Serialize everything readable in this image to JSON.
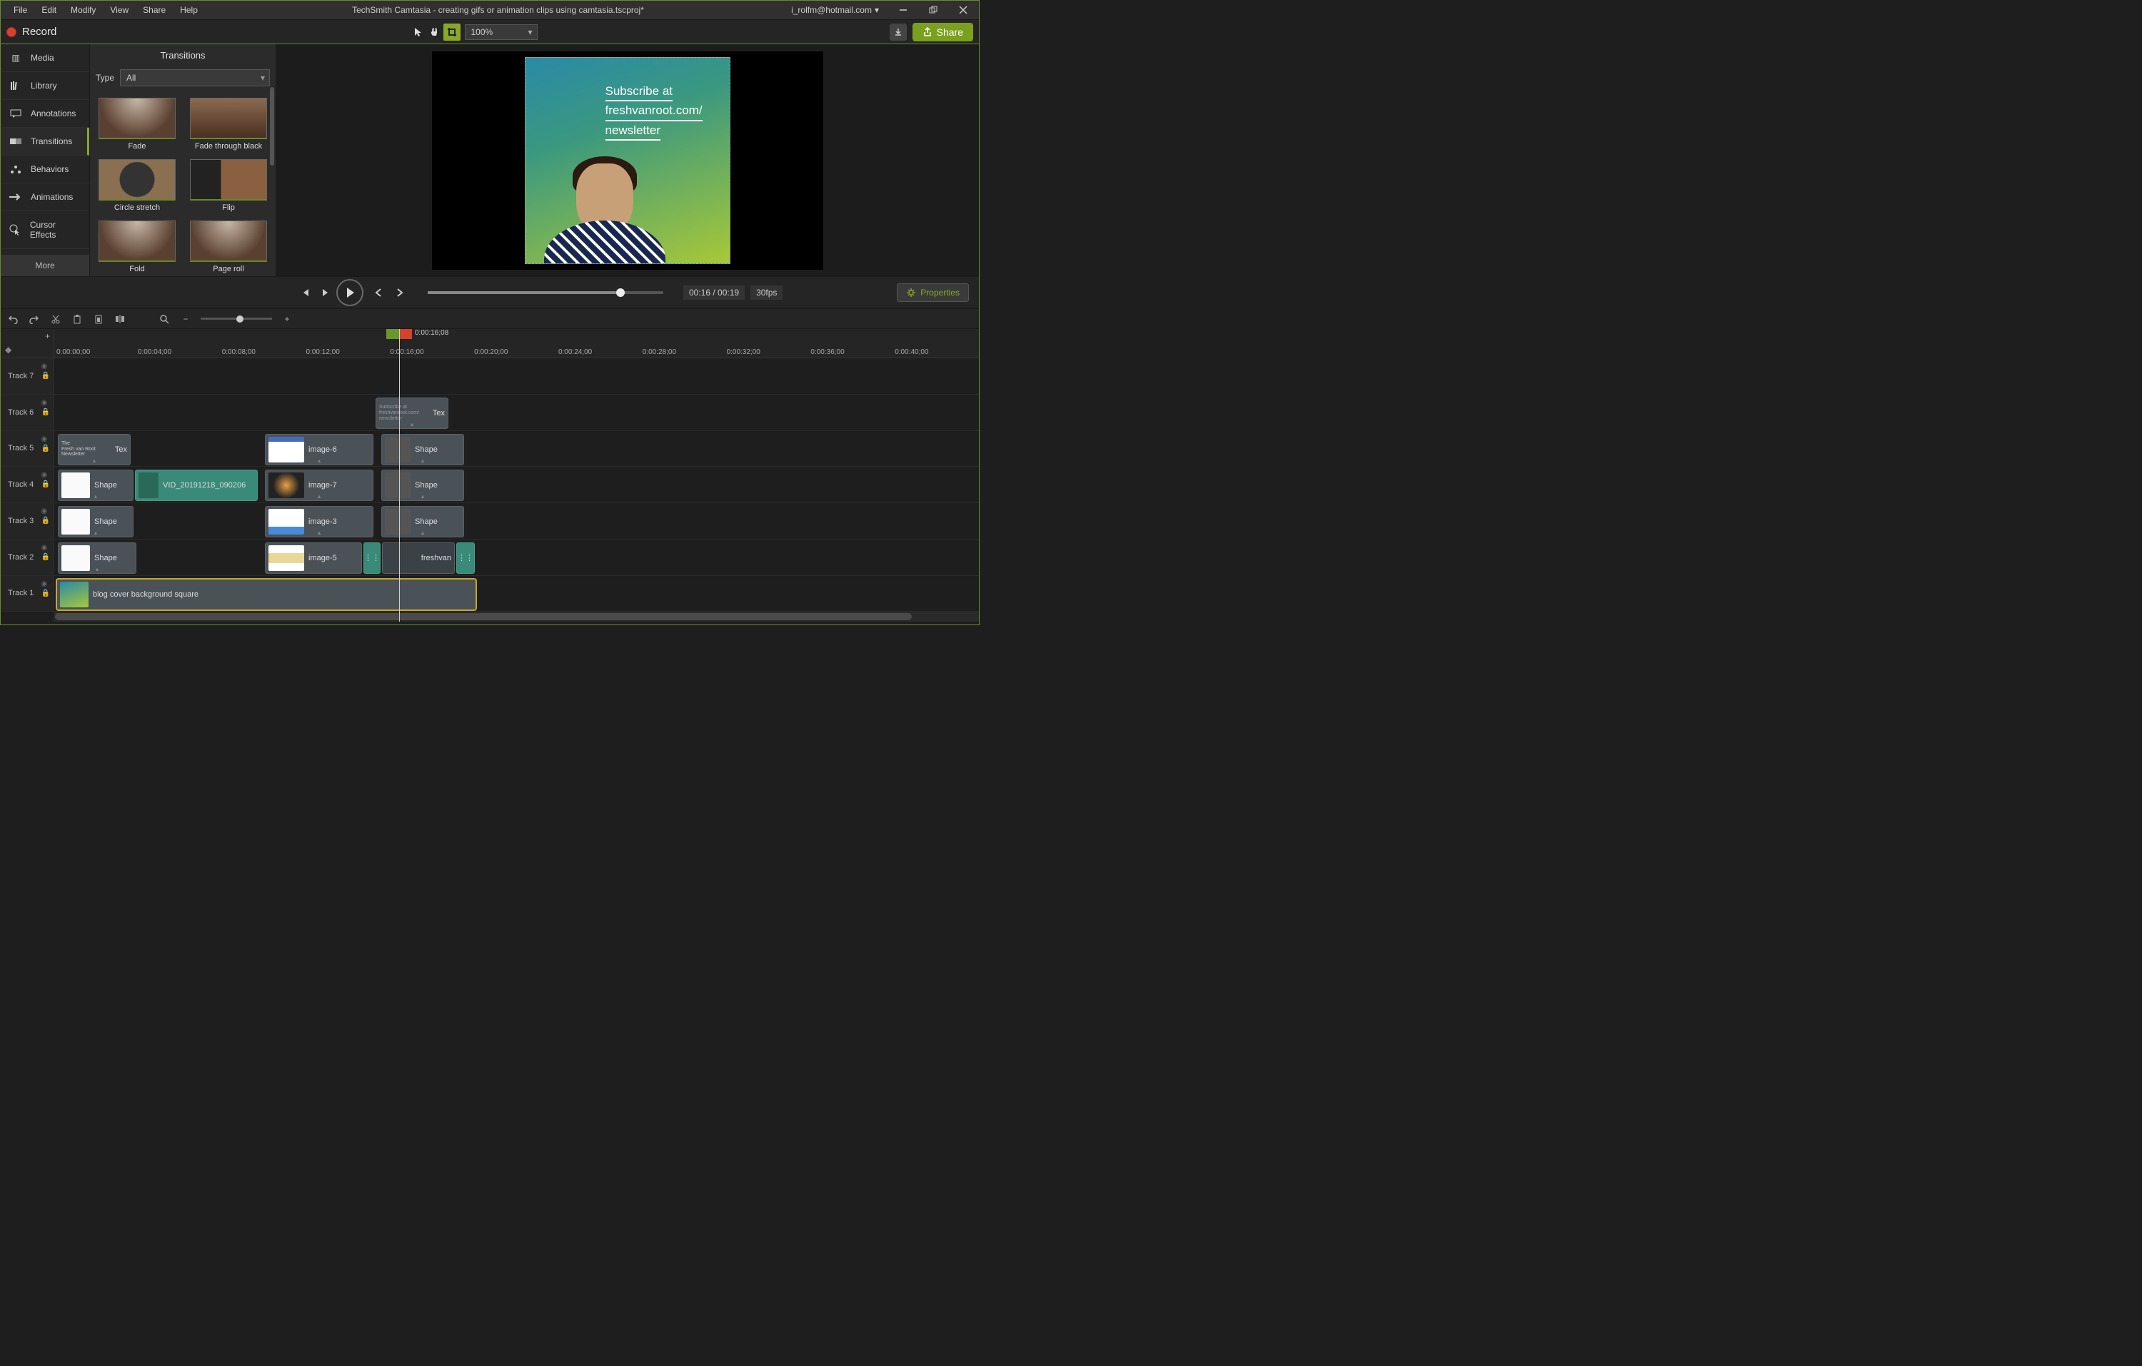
{
  "titlebar": {
    "menus": [
      "File",
      "Edit",
      "Modify",
      "View",
      "Share",
      "Help"
    ],
    "title": "TechSmith Camtasia - creating gifs or animation clips using camtasia.tscproj*",
    "user": "i_rolfm@hotmail.com"
  },
  "toolbar": {
    "record_label": "Record",
    "zoom": "100%",
    "share_label": "Share"
  },
  "sidebar": {
    "tabs": [
      {
        "label": "Media"
      },
      {
        "label": "Library"
      },
      {
        "label": "Annotations"
      },
      {
        "label": "Transitions"
      },
      {
        "label": "Behaviors"
      },
      {
        "label": "Animations"
      },
      {
        "label": "Cursor Effects"
      }
    ],
    "more_label": "More"
  },
  "transitions": {
    "header": "Transitions",
    "type_label": "Type",
    "type_value": "All",
    "items": [
      {
        "name": "Fade"
      },
      {
        "name": "Fade through black"
      },
      {
        "name": "Circle stretch"
      },
      {
        "name": "Flip"
      },
      {
        "name": "Fold"
      },
      {
        "name": "Page roll"
      }
    ]
  },
  "canvas": {
    "overlay_text": {
      "line1": "Subscribe at",
      "line2": "freshvanroot.com/",
      "line3": "newsletter"
    }
  },
  "playback": {
    "current": "00:16",
    "total": "00:19",
    "fps": "30fps",
    "properties_label": "Properties"
  },
  "timeline": {
    "playhead_time": "0:00:16;08",
    "ruler": [
      "0:00:00;00",
      "0:00:04;00",
      "0:00:08;00",
      "0:00:12;00",
      "0:00:16;00",
      "0:00:20;00",
      "0:00:24;00",
      "0:00:28;00",
      "0:00:32;00",
      "0:00:36;00",
      "0:00:40;00"
    ],
    "tracks": [
      {
        "name": "Track 7"
      },
      {
        "name": "Track 6"
      },
      {
        "name": "Track 5"
      },
      {
        "name": "Track 4"
      },
      {
        "name": "Track 3"
      },
      {
        "name": "Track 2"
      },
      {
        "name": "Track 1"
      }
    ],
    "clips": {
      "t6_tex": "Tex",
      "t5_text1": "Tex",
      "t5_text1_sub": "The\nFresh van Root\nNewsletter",
      "t5_img6": "image-6",
      "t5_shape": "Shape",
      "t4_shape": "Shape",
      "t4_vid": "VID_20191218_090206",
      "t4_img7": "image-7",
      "t4_shape2": "Shape",
      "t3_shape": "Shape",
      "t3_img3": "image-3",
      "t3_shape2": "Shape",
      "t2_shape": "Shape",
      "t2_img5": "image-5",
      "t2_fresh": "freshvan",
      "t1_bg": "blog cover background square"
    }
  }
}
